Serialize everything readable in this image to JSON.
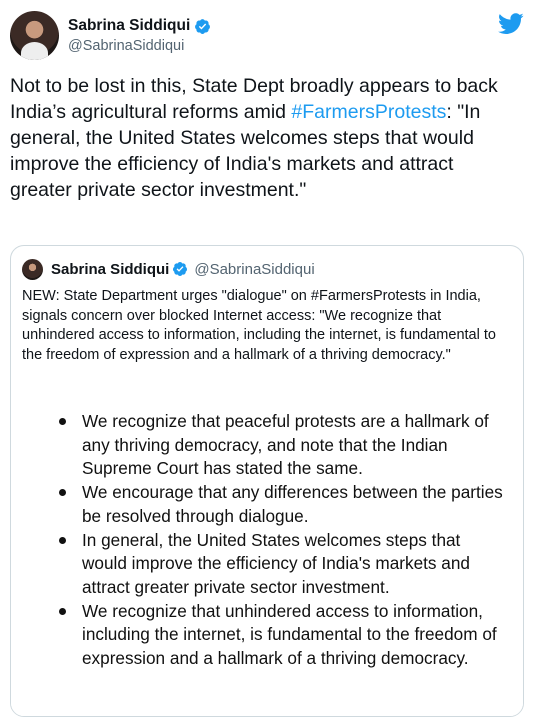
{
  "tweet": {
    "author": {
      "name": "Sabrina Siddiqui",
      "handle": "@SabrinaSiddiqui",
      "verified_icon": "verified-badge-icon"
    },
    "logo_icon": "twitter-bird-icon",
    "text_before_hashtag": "Not to be lost in this, State Dept broadly appears to back India’s agricultural reforms amid ",
    "hashtag": "#FarmersProtests",
    "text_after_hashtag": ": \"In general, the United States welcomes steps that would improve the efficiency of India's markets and attract greater private sector investment.\""
  },
  "quoted_tweet": {
    "author": {
      "name": "Sabrina Siddiqui",
      "handle": "@SabrinaSiddiqui"
    },
    "text": "NEW: State Department urges \"dialogue\" on #FarmersProtests in India, signals concern over blocked Internet access: \"We recognize that unhindered access to information, including the internet, is fundamental to the freedom of expression and a hallmark of a thriving democracy.\"",
    "image_bullets": [
      "We recognize that peaceful protests are a hallmark of any thriving democracy, and note that the Indian Supreme Court has stated the same.",
      "We encourage that any differences between the parties be resolved through dialogue.",
      "In general, the United States welcomes steps that would improve the efficiency of India's markets and attract greater private sector investment.",
      "We recognize that unhindered access to information, including the internet, is fundamental to the freedom of expression and a hallmark of a thriving democracy."
    ]
  },
  "colors": {
    "link_blue": "#1d9bf0",
    "text_primary": "#0f1419",
    "text_secondary": "#536471",
    "border": "#cfd9de"
  }
}
